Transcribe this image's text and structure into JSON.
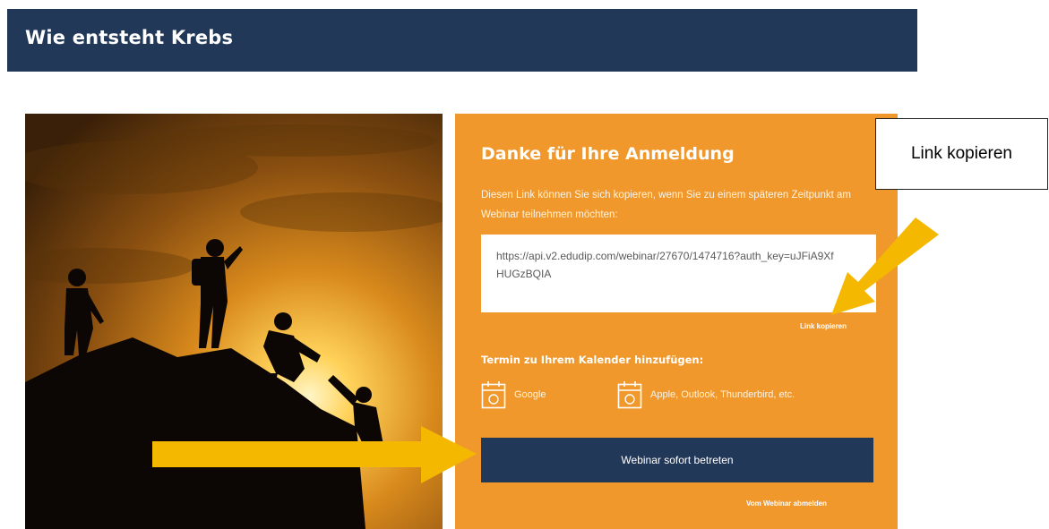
{
  "header": {
    "title": "Wie entsteht Krebs"
  },
  "panel": {
    "heading": "Danke für Ihre Anmeldung",
    "intro": "Diesen Link können Sie sich kopieren, wenn Sie zu einem späteren Zeitpunkt am Webinar teilnehmen möchten:",
    "url": "https://api.v2.edudip.com/webinar/27670/1474716?auth_key=uJFiA9XfHUGzBQIA",
    "copy_label": "Link kopieren",
    "calendar_label": "Termin zu Ihrem Kalender hinzufügen:",
    "calendar_google": "Google",
    "calendar_other": "Apple, Outlook, Thunderbird, etc.",
    "enter_button": "Webinar sofort betreten",
    "unsubscribe": "Vom Webinar abmelden"
  },
  "callout": {
    "text": "Link kopieren"
  },
  "icons": {
    "calendar": "calendar-icon",
    "arrow": "arrow-icon"
  },
  "colors": {
    "navy": "#223858",
    "orange": "#f0982c",
    "arrow": "#f5b800"
  }
}
